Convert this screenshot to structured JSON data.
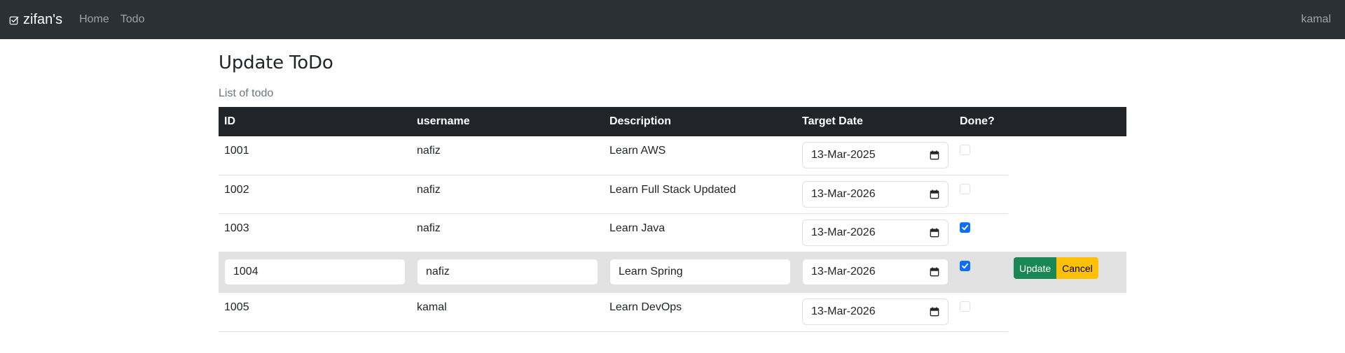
{
  "navbar": {
    "brand": "zifan's",
    "links": [
      "Home",
      "Todo"
    ],
    "user": "kamal"
  },
  "page": {
    "title": "Update ToDo",
    "subtitle": "List of todo"
  },
  "table": {
    "headers": [
      "ID",
      "username",
      "Description",
      "Target Date",
      "Done?"
    ],
    "rows": [
      {
        "id": "1001",
        "username": "nafiz",
        "description": "Learn AWS",
        "target_date": "13-Mar-2025",
        "done": false
      },
      {
        "id": "1002",
        "username": "nafiz",
        "description": "Learn Full Stack Updated",
        "target_date": "13-Mar-2026",
        "done": false
      },
      {
        "id": "1003",
        "username": "nafiz",
        "description": "Learn Java",
        "target_date": "13-Mar-2026",
        "done": true
      },
      {
        "id": "1004",
        "username": "nafiz",
        "description": "Learn Spring",
        "target_date": "13-Mar-2026",
        "done": true
      },
      {
        "id": "1005",
        "username": "kamal",
        "description": "Learn DevOps",
        "target_date": "13-Mar-2026",
        "done": false
      }
    ],
    "edit_actions": {
      "update_label": "Update",
      "cancel_label": "Cancel"
    }
  },
  "colors": {
    "navbar_bg": "#2b3035",
    "header_bg": "#212529",
    "editing_row_bg": "#e2e2e2",
    "update_button": "#198754",
    "cancel_button": "#ffc107",
    "checkbox_checked": "#0d6efd"
  },
  "icons": {
    "brand": "check-square-icon",
    "date_picker": "calendar-icon"
  }
}
